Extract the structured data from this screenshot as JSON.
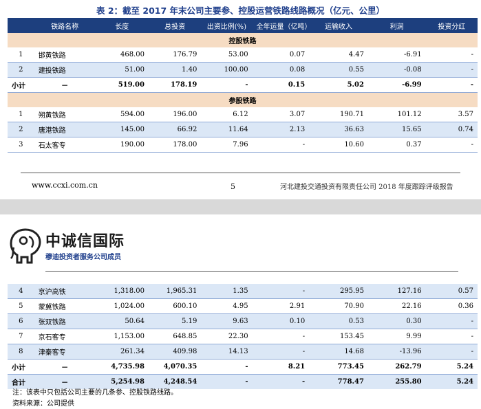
{
  "page1": {
    "caption": "表 2：截至 2017 年末公司主要参、控股运营铁路线路概况（亿元、公里）",
    "headers": [
      "",
      "铁路名称",
      "长度",
      "总投资",
      "出资比例(%)",
      "全年运量（亿吨）",
      "运输收入",
      "利润",
      "投资分红"
    ],
    "section_control": "控股铁路",
    "control_rows": [
      [
        "1",
        "邯黄铁路",
        "468.00",
        "176.79",
        "53.00",
        "0.07",
        "4.47",
        "-6.91",
        "-"
      ],
      [
        "2",
        "建投铁路",
        "51.00",
        "1.40",
        "100.00",
        "0.08",
        "0.55",
        "-0.08",
        "-"
      ]
    ],
    "control_subtotal": [
      "小计",
      "－",
      "519.00",
      "178.19",
      "-",
      "0.15",
      "5.02",
      "-6.99",
      "-"
    ],
    "section_equity": "参股铁路",
    "equity_rows": [
      [
        "1",
        "朔黄铁路",
        "594.00",
        "196.00",
        "6.12",
        "3.07",
        "190.71",
        "101.12",
        "3.57"
      ],
      [
        "2",
        "唐港铁路",
        "145.00",
        "66.92",
        "11.64",
        "2.13",
        "36.63",
        "15.65",
        "0.74"
      ],
      [
        "3",
        "石太客专",
        "190.00",
        "178.00",
        "7.96",
        "-",
        "10.60",
        "0.37",
        "-"
      ]
    ],
    "footer": {
      "url": "www.ccxi.com.cn",
      "page_number": "5",
      "report_name": "河北建投交通投资有限责任公司 2018 年度跟踪评级报告"
    }
  },
  "page2": {
    "logo_text": "中诚信国际",
    "logo_subtitle": "穆迪投资者服务公司成员",
    "rows": [
      [
        "4",
        "京沪高铁",
        "1,318.00",
        "1,965.31",
        "1.35",
        "-",
        "295.95",
        "127.16",
        "0.57"
      ],
      [
        "5",
        "蒙冀铁路",
        "1,024.00",
        "600.10",
        "4.95",
        "2.91",
        "70.90",
        "22.16",
        "0.36"
      ],
      [
        "6",
        "张双铁路",
        "50.64",
        "5.19",
        "9.63",
        "0.10",
        "0.53",
        "0.30",
        "-"
      ],
      [
        "7",
        "京石客专",
        "1,153.00",
        "648.85",
        "22.30",
        "-",
        "153.45",
        "9.99",
        "-"
      ],
      [
        "8",
        "津秦客专",
        "261.34",
        "409.98",
        "14.13",
        "-",
        "14.68",
        "-13.96",
        "-"
      ]
    ],
    "subtotal": [
      "小计",
      "－",
      "4,735.98",
      "4,070.35",
      "-",
      "8.21",
      "773.45",
      "262.79",
      "5.24"
    ],
    "total": [
      "合计",
      "－",
      "5,254.98",
      "4,248.54",
      "-",
      "-",
      "778.47",
      "255.80",
      "5.24"
    ],
    "note": "注：该表中只包括公司主要的几条参、控股铁路线路。",
    "source": "资料来源：公司提供"
  },
  "colors": {
    "header_bg": "#1d3f7e",
    "section_bg": "#f6dcc3",
    "alt_row_bg": "#dbe7f6",
    "caption_color": "#1f3f8c"
  }
}
